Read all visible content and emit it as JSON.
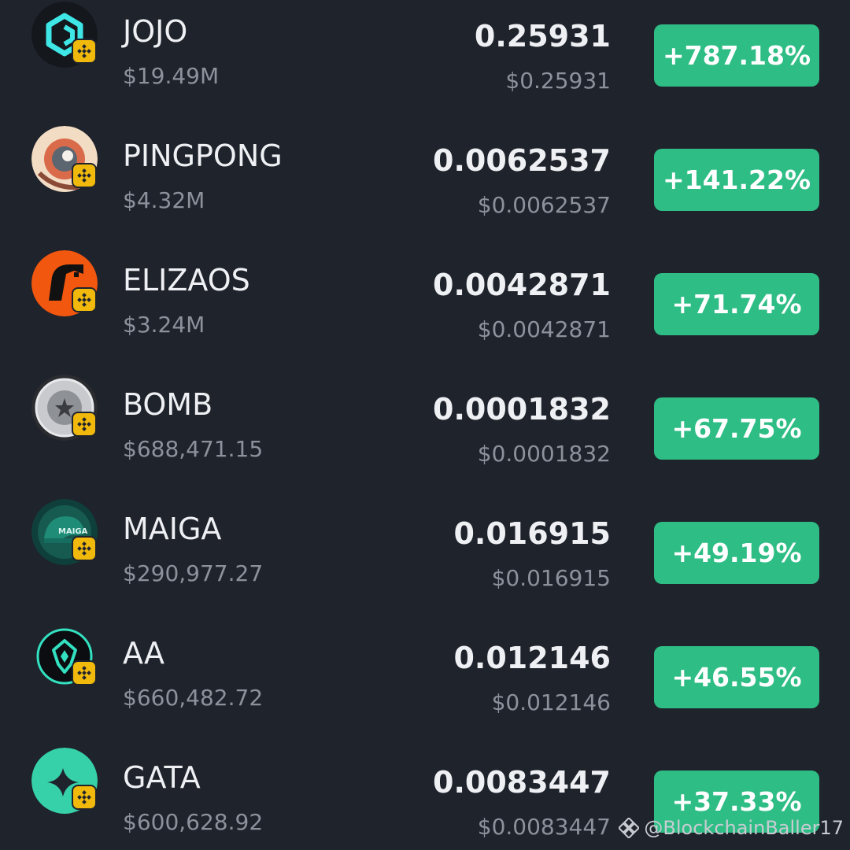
{
  "colors": {
    "background": "#1f232c",
    "positive_badge": "#2ebd85",
    "chain_badge": "#f0b90b",
    "secondary_text": "#8c929c"
  },
  "tokens": [
    {
      "symbol": "JOJO",
      "market_cap": "$19.49M",
      "price": "0.25931",
      "price_usd": "$0.25931",
      "change": "+787.18%",
      "icon": "jojo-logo-icon",
      "chain_icon": "bnb-chain-icon"
    },
    {
      "symbol": "PINGPONG",
      "market_cap": "$4.32M",
      "price": "0.0062537",
      "price_usd": "$0.0062537",
      "change": "+141.22%",
      "icon": "pingpong-logo-icon",
      "chain_icon": "bnb-chain-icon"
    },
    {
      "symbol": "ELIZAOS",
      "market_cap": "$3.24M",
      "price": "0.0042871",
      "price_usd": "$0.0042871",
      "change": "+71.74%",
      "icon": "elizaos-logo-icon",
      "chain_icon": "bnb-chain-icon"
    },
    {
      "symbol": "BOMB",
      "market_cap": "$688,471.15",
      "price": "0.0001832",
      "price_usd": "$0.0001832",
      "change": "+67.75%",
      "icon": "bomb-logo-icon",
      "chain_icon": "bnb-chain-icon"
    },
    {
      "symbol": "MAIGA",
      "market_cap": "$290,977.27",
      "price": "0.016915",
      "price_usd": "$0.016915",
      "change": "+49.19%",
      "icon": "maiga-logo-icon",
      "chain_icon": "bnb-chain-icon"
    },
    {
      "symbol": "AA",
      "market_cap": "$660,482.72",
      "price": "0.012146",
      "price_usd": "$0.012146",
      "change": "+46.55%",
      "icon": "aa-logo-icon",
      "chain_icon": "bnb-chain-icon"
    },
    {
      "symbol": "GATA",
      "market_cap": "$600,628.92",
      "price": "0.0083447",
      "price_usd": "$0.0083447",
      "change": "+37.33%",
      "icon": "gata-logo-icon",
      "chain_icon": "bnb-chain-icon"
    }
  ],
  "watermark": {
    "text": "@BlockchainBaller17",
    "icon": "binance-logo-icon"
  }
}
